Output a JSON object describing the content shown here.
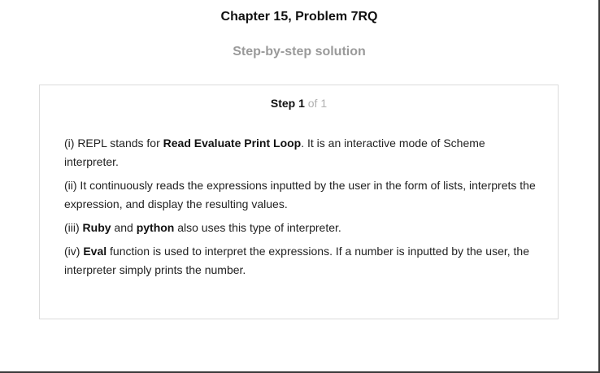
{
  "header": {
    "title": "Chapter 15, Problem 7RQ",
    "subtitle": "Step-by-step solution"
  },
  "step": {
    "label": "Step 1",
    "of": "of 1"
  },
  "paragraphs": {
    "p1": {
      "a": "(i) REPL stands for ",
      "b": "Read Evaluate Print Loop",
      "c": ". It is an interactive mode of Scheme interpreter."
    },
    "p2": {
      "a": "(ii) It continuously reads the expressions inputted by the user in the form of lists, interprets the expression, and display the resulting values."
    },
    "p3": {
      "a": "(iii) ",
      "b": "Ruby",
      "c": " and ",
      "d": "python",
      "e": " also uses this type of interpreter."
    },
    "p4": {
      "a": "(iv) ",
      "b": "Eval",
      "c": " function is used to interpret the expressions. If a number is inputted by the user, the interpreter simply prints the number."
    }
  }
}
